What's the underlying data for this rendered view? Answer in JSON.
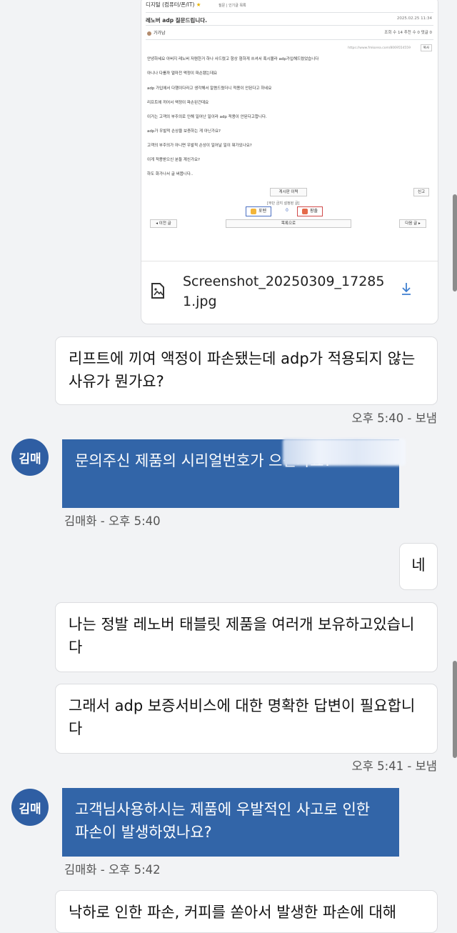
{
  "attachment": {
    "preview": {
      "breadcrumb": "디지털 (컴퓨터/폰/IT)",
      "breadcrumb_links": "질문  |  인기글 목록",
      "post_title": "레노버 adp 질문드립니다.",
      "post_date": "2025.02.25 11:34",
      "author": "가가남",
      "stats": "조회 수 14   추천 수 0   댓글 0",
      "url": "https://www.fmkorea.com/8069554559",
      "copy_label": "복사",
      "body_lines": [
        "안녕하세요 아버지 레노버 저렴한거 하나 사드렸고 항상 험하게 쓰셔서 혹시몰라 adp가입해드렸었습니다",
        "아니나 다를까 얼마전 액정이 파손됐는데요",
        "adp 가입에서 다행이다라고 생각해서 알씀드렸더니 적용이 안된다고 하네요",
        "리프트에 끼어서 액정이 파손된건데요",
        "이거는 고객의 부주의로 인해 일어난 일이라 adp 적용이 안된다고합니다.",
        "adp가 우발적 손상을 보증하는 게 아닌가요?",
        "고객의 부주의가 아니면 우발적 손상이 일어날 일이 뭐가있나요?",
        "이게 적용받으신 분들 계신가요?",
        "하도 화가나서 글 써봅니다.."
      ],
      "history_button": "게시판 이력",
      "report_button": "신고",
      "policy_text": "[무단 금지 설정된 글]",
      "vote_up": "포텐",
      "vote_count": "0",
      "vote_down": "팡출",
      "prev_button": "◂ 이전 글",
      "list_button": "목록으로",
      "next_button": "다음 글 ▸"
    },
    "file_name": "Screenshot_20250309_172851.jpg"
  },
  "messages": [
    {
      "text": "리프트에 끼여 액정이 파손됐는데 adp가 적용되지 않는 사유가 뭔가요?"
    },
    {
      "meta": "오후 5:40 - 보냄"
    },
    {
      "avatar": "김매",
      "text": "문의주신 제품의 시리얼번호가 으신가요?",
      "meta": "김매화 - 오후 5:40"
    },
    {
      "text": "네"
    },
    {
      "text": "나는 정발 레노버 태블릿 제품을 여러개 보유하고있습니다"
    },
    {
      "text": "그래서 adp 보증서비스에 대한 명확한 답변이 필요합니다"
    },
    {
      "meta": "오후 5:41 - 보냄"
    },
    {
      "avatar": "김매",
      "text": "고객님사용하시는 제품에 우발적인 사고로 인한 파손이 발생하였나요?",
      "meta": "김매화 - 오후 5:42"
    },
    {
      "text": "낙하로 인한 파손, 커피를 쏟아서 발생한 파손에 대해"
    }
  ],
  "colors": {
    "background": "#f2f3f5",
    "agent_bubble": "#3265a8",
    "avatar": "#2f5ea3",
    "user_bubble": "#ffffff"
  },
  "icons": {
    "file": "image-file-icon",
    "download": "download-icon"
  }
}
